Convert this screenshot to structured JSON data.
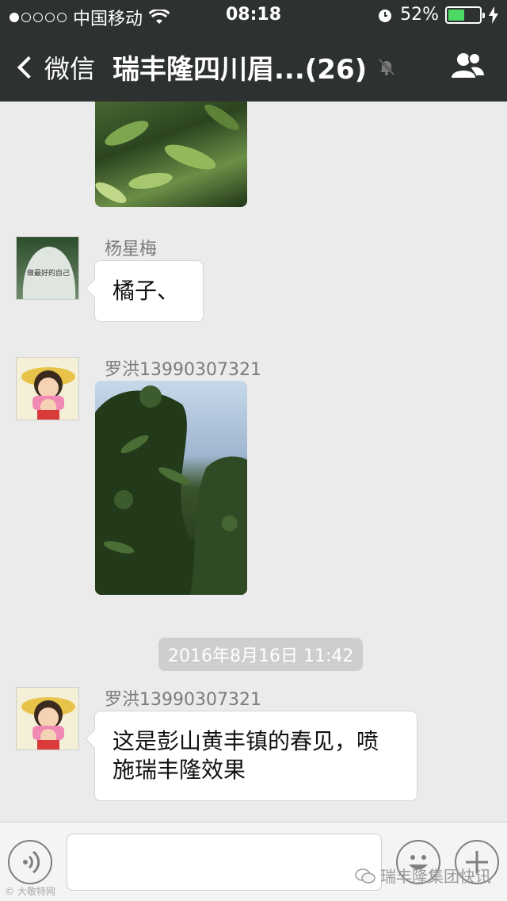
{
  "status_bar": {
    "carrier": "中国移动",
    "time": "08:18",
    "battery_percent": "52%",
    "battery_level": 0.52,
    "signal_dots_filled": 1,
    "signal_dots_total": 5
  },
  "nav": {
    "back_label": "微信",
    "title": "瑞丰隆四川眉...(26)"
  },
  "messages": [
    {
      "sender": "杨星梅",
      "text": "橘子、"
    },
    {
      "sender": "罗洪13990307321"
    },
    {
      "timestamp": "2016年8月16日 11:42"
    },
    {
      "sender": "罗洪13990307321",
      "text": "这是彭山黄丰镇的春见，喷施瑞丰隆效果"
    }
  ],
  "avatar_text": "做最好的自己",
  "watermark": {
    "right": "瑞丰隆集团快讯",
    "left": "© 大敬特网"
  },
  "colors": {
    "nav_bg": "#2e3132",
    "chat_bg": "#ebebeb",
    "battery_fill": "#4cd964"
  },
  "icons": [
    "wifi-icon",
    "alarm-icon",
    "charging-icon",
    "mute-bell-icon",
    "group-info-icon",
    "voice-icon",
    "emoji-icon",
    "plus-icon"
  ]
}
